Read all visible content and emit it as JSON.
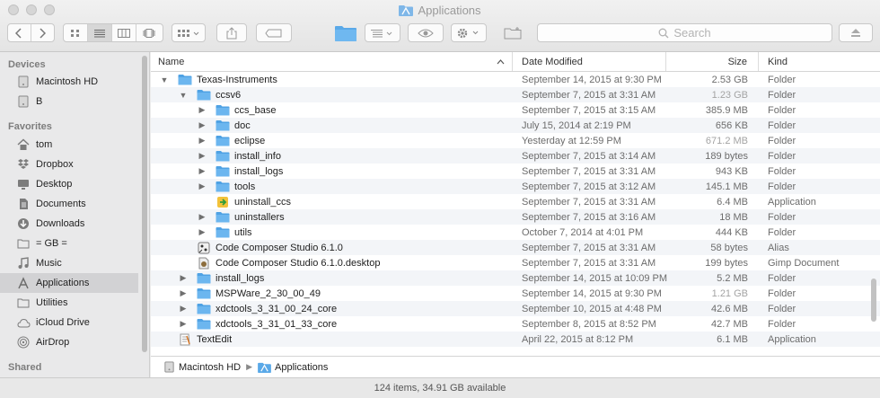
{
  "window": {
    "title": "Applications"
  },
  "toolbar": {
    "search_placeholder": "Search"
  },
  "sidebar": {
    "sections": [
      {
        "label": "Devices",
        "items": [
          {
            "label": "Macintosh HD",
            "icon": "hard-drive-icon"
          },
          {
            "label": "B",
            "icon": "hard-drive-icon"
          }
        ]
      },
      {
        "label": "Favorites",
        "items": [
          {
            "label": "tom",
            "icon": "home-icon"
          },
          {
            "label": "Dropbox",
            "icon": "dropbox-icon"
          },
          {
            "label": "Desktop",
            "icon": "desktop-icon"
          },
          {
            "label": "Documents",
            "icon": "documents-icon"
          },
          {
            "label": "Downloads",
            "icon": "downloads-icon"
          },
          {
            "label": "= GB =",
            "icon": "folder-icon"
          },
          {
            "label": "Music",
            "icon": "music-icon"
          },
          {
            "label": "Applications",
            "icon": "applications-icon",
            "active": true
          },
          {
            "label": "Utilities",
            "icon": "folder-icon"
          },
          {
            "label": "iCloud Drive",
            "icon": "cloud-icon"
          },
          {
            "label": "AirDrop",
            "icon": "airdrop-icon"
          }
        ]
      },
      {
        "label": "Shared",
        "items": []
      }
    ]
  },
  "columns": {
    "name": "Name",
    "date": "Date Modified",
    "size": "Size",
    "kind": "Kind"
  },
  "rows": [
    {
      "name": "Texas-Instruments",
      "date": "September 14, 2015 at 9:30 PM",
      "size": "2.53 GB",
      "kind": "Folder",
      "indent": 0,
      "expanded": true,
      "icon": "folder"
    },
    {
      "name": "ccsv6",
      "date": "September 7, 2015 at 3:31 AM",
      "size": "1.23 GB",
      "kind": "Folder",
      "indent": 1,
      "expanded": true,
      "icon": "folder",
      "size_dim": true
    },
    {
      "name": "ccs_base",
      "date": "September 7, 2015 at 3:15 AM",
      "size": "385.9 MB",
      "kind": "Folder",
      "indent": 2,
      "expanded": false,
      "icon": "folder"
    },
    {
      "name": "doc",
      "date": "July 15, 2014 at 2:19 PM",
      "size": "656 KB",
      "kind": "Folder",
      "indent": 2,
      "expanded": false,
      "icon": "folder"
    },
    {
      "name": "eclipse",
      "date": "Yesterday at 12:59 PM",
      "size": "671.2 MB",
      "kind": "Folder",
      "indent": 2,
      "expanded": false,
      "icon": "folder",
      "size_dim": true
    },
    {
      "name": "install_info",
      "date": "September 7, 2015 at 3:14 AM",
      "size": "189 bytes",
      "kind": "Folder",
      "indent": 2,
      "expanded": false,
      "icon": "folder"
    },
    {
      "name": "install_logs",
      "date": "September 7, 2015 at 3:31 AM",
      "size": "943 KB",
      "kind": "Folder",
      "indent": 2,
      "expanded": false,
      "icon": "folder"
    },
    {
      "name": "tools",
      "date": "September 7, 2015 at 3:12 AM",
      "size": "145.1 MB",
      "kind": "Folder",
      "indent": 2,
      "expanded": false,
      "icon": "folder"
    },
    {
      "name": "uninstall_ccs",
      "date": "September 7, 2015 at 3:31 AM",
      "size": "6.4 MB",
      "kind": "Application",
      "indent": 2,
      "expanded": null,
      "icon": "app"
    },
    {
      "name": "uninstallers",
      "date": "September 7, 2015 at 3:16 AM",
      "size": "18 MB",
      "kind": "Folder",
      "indent": 2,
      "expanded": false,
      "icon": "folder"
    },
    {
      "name": "utils",
      "date": "October 7, 2014 at 4:01 PM",
      "size": "444 KB",
      "kind": "Folder",
      "indent": 2,
      "expanded": false,
      "icon": "folder"
    },
    {
      "name": "Code Composer Studio 6.1.0",
      "date": "September 7, 2015 at 3:31 AM",
      "size": "58 bytes",
      "kind": "Alias",
      "indent": 1,
      "expanded": null,
      "icon": "alias"
    },
    {
      "name": "Code Composer Studio 6.1.0.desktop",
      "date": "September 7, 2015 at 3:31 AM",
      "size": "199 bytes",
      "kind": "Gimp Document",
      "indent": 1,
      "expanded": null,
      "icon": "doc"
    },
    {
      "name": "install_logs",
      "date": "September 14, 2015 at 10:09 PM",
      "size": "5.2 MB",
      "kind": "Folder",
      "indent": 1,
      "expanded": false,
      "icon": "folder"
    },
    {
      "name": "MSPWare_2_30_00_49",
      "date": "September 14, 2015 at 9:30 PM",
      "size": "1.21 GB",
      "kind": "Folder",
      "indent": 1,
      "expanded": false,
      "icon": "folder",
      "size_dim": true
    },
    {
      "name": "xdctools_3_31_00_24_core",
      "date": "September 10, 2015 at 4:48 PM",
      "size": "42.6 MB",
      "kind": "Folder",
      "indent": 1,
      "expanded": false,
      "icon": "folder"
    },
    {
      "name": "xdctools_3_31_01_33_core",
      "date": "September 8, 2015 at 8:52 PM",
      "size": "42.7 MB",
      "kind": "Folder",
      "indent": 1,
      "expanded": false,
      "icon": "folder"
    },
    {
      "name": "TextEdit",
      "date": "April 22, 2015 at 8:12 PM",
      "size": "6.1 MB",
      "kind": "Application",
      "indent": 0,
      "expanded": null,
      "icon": "textedit"
    }
  ],
  "pathbar": {
    "items": [
      "Macintosh HD",
      "Applications"
    ]
  },
  "status": {
    "text": "124 items, 34.91 GB available"
  },
  "colors": {
    "folder": "#5aa9e8",
    "selected_sidebar": "#d2d2d4",
    "row_alt": "#f3f5f8"
  }
}
